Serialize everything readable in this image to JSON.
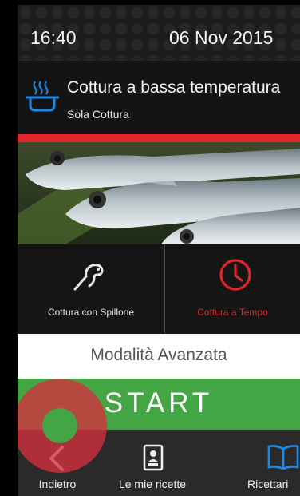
{
  "status": {
    "time": "16:40",
    "date": "06 Nov 2015"
  },
  "header": {
    "title": "Cottura a bassa temperatura",
    "subtitle": "Sola Cottura",
    "icon": "pot-icon"
  },
  "modes": [
    {
      "label": "Cottura con Spillone",
      "icon": "probe-icon",
      "selected": false
    },
    {
      "label": "Cottura a Tempo",
      "icon": "clock-icon",
      "selected": true
    }
  ],
  "advanced_label": "Modalità Avanzata",
  "start_label": "START",
  "nav": {
    "back": "Indietro",
    "my_recipes": "Le mie ricette",
    "recipes": "Ricettari"
  },
  "colors": {
    "accent_red": "#e0252b",
    "start_green": "#44a545",
    "pot_blue": "#1e88e5"
  }
}
